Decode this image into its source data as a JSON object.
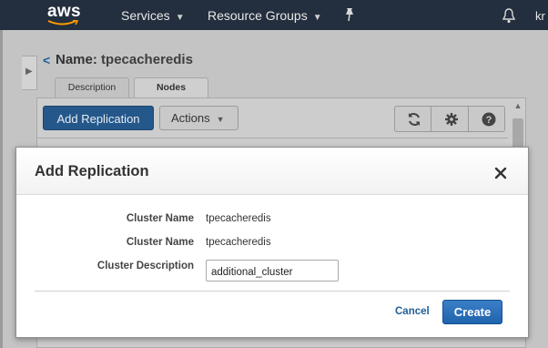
{
  "topnav": {
    "logo": "aws",
    "services_label": "Services",
    "resource_groups_label": "Resource Groups",
    "user_truncated": "kr"
  },
  "page": {
    "back_label": "<",
    "name_key": "Name:",
    "name_value": "tpecacheredis",
    "tabs": [
      {
        "label": "Description",
        "active": false
      },
      {
        "label": "Nodes",
        "active": true
      }
    ],
    "toolbar": {
      "add_replication_label": "Add Replication",
      "actions_label": "Actions"
    }
  },
  "modal": {
    "title": "Add Replication",
    "fields": [
      {
        "label": "Cluster Name",
        "value": "tpecacheredis"
      },
      {
        "label": "Cluster Name",
        "value": "tpecacheredis"
      }
    ],
    "description_label": "Cluster Description",
    "description_value": "additional_cluster",
    "cancel_label": "Cancel",
    "create_label": "Create"
  },
  "colors": {
    "nav_bg": "#232f3e",
    "primary_button": "#1f63ad",
    "link": "#1f5e98"
  },
  "icons": [
    "aws-logo",
    "chevron-down-icon",
    "pin-icon",
    "bell-icon",
    "refresh-icon",
    "gear-icon",
    "help-icon",
    "close-icon"
  ]
}
